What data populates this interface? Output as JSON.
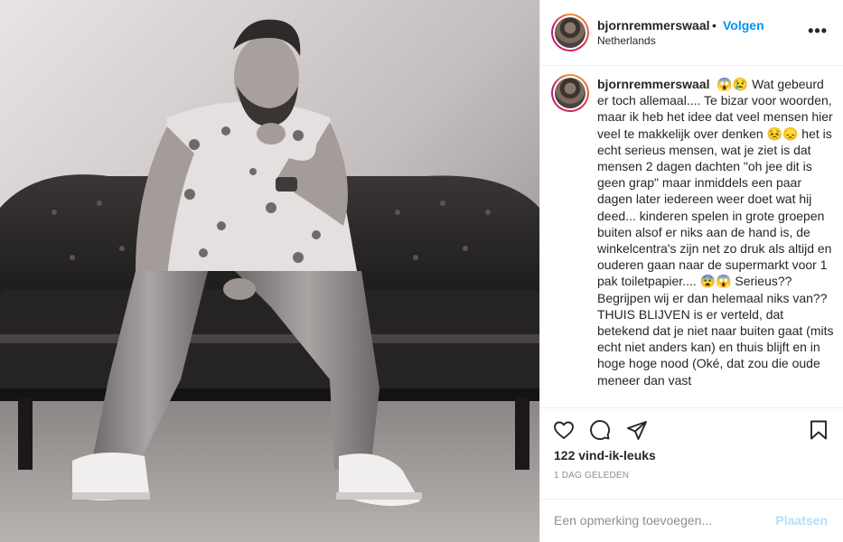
{
  "post": {
    "image_alt": "Black and white photo of a bearded man in a floral shirt and jeans sitting on a tufted leather chaise"
  },
  "header": {
    "username": "bjornremmerswaal",
    "separator": "•",
    "follow_label": "Volgen",
    "location": "Netherlands",
    "more_label": "•••"
  },
  "caption": {
    "username": "bjornremmerswaal",
    "text": "😱😢 Wat gebeurd er toch allemaal.... Te bizar voor woorden, maar ik heb het idee dat veel mensen hier veel te makkelijk over denken 😣😞 het is echt serieus mensen, wat je ziet is dat mensen 2 dagen dachten \"oh jee dit is geen grap\" maar inmiddels een paar dagen later iedereen weer doet wat hij deed... kinderen spelen in grote groepen buiten alsof er niks aan de hand is, de winkelcentra's zijn net zo druk als altijd en ouderen gaan naar de supermarkt voor 1 pak toiletpapier.... 😨😱 Serieus?? Begrijpen wij er dan helemaal niks van?? THUIS BLIJVEN is er verteld, dat betekend dat je niet naar buiten gaat (mits echt niet anders kan) en thuis blijft en in hoge hoge nood (Oké, dat zou die oude meneer dan vast"
  },
  "actions": {
    "likes": "122 vind-ik-leuks",
    "timestamp": "1 DAG GELEDEN"
  },
  "comment": {
    "placeholder": "Een opmerking toevoegen...",
    "post_label": "Plaatsen"
  },
  "colors": {
    "accent": "#0095f6",
    "post_disabled": "#b2dffc",
    "muted": "#8e8e8e",
    "text": "#262626",
    "border": "#efefef"
  }
}
